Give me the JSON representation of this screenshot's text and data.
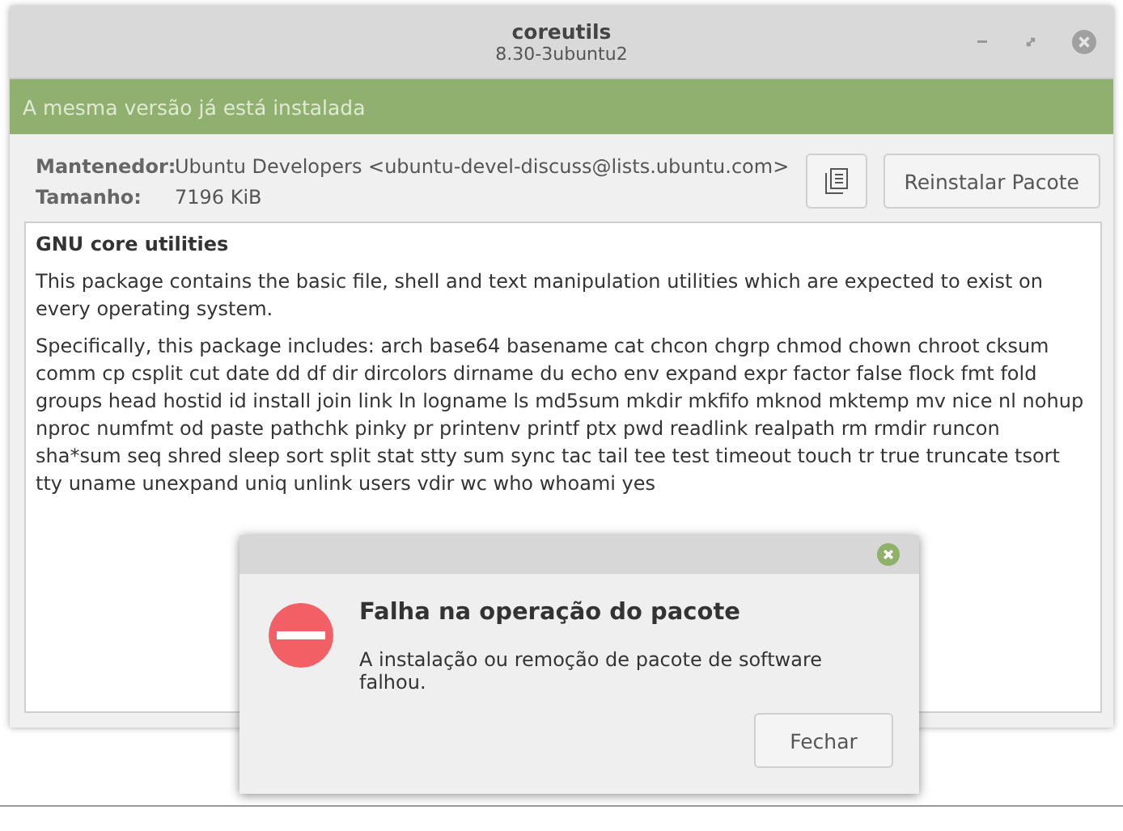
{
  "window": {
    "title": "coreutils",
    "subtitle": "8.30-3ubuntu2"
  },
  "banner": "A mesma versão já está instalada",
  "info": [
    {
      "label": "Mantenedor:",
      "value": "Ubuntu Developers <ubuntu-devel-discuss@lists.ubuntu.com>"
    },
    {
      "label": "Tamanho:",
      "value": "7196 KiB"
    }
  ],
  "reinstall_button": "Reinstalar Pacote",
  "description": {
    "title": "GNU core utilities",
    "paragraphs": [
      "This package contains the basic file, shell and text manipulation utilities which are expected to exist on every operating system.",
      "Specifically, this package includes: arch base64 basename cat chcon chgrp chmod chown chroot cksum comm cp csplit cut date dd df dir dircolors dirname du echo env expand expr factor false flock fmt fold groups head hostid id install join link ln logname ls md5sum mkdir mkfifo mknod mktemp mv nice nl nohup nproc numfmt od paste pathchk pinky pr printenv printf ptx pwd readlink realpath rm rmdir runcon sha*sum seq shred sleep sort split stat stty sum sync tac tail tee test timeout touch tr true truncate tsort tty uname unexpand uniq unlink users vdir wc who whoami yes"
    ]
  },
  "dialog": {
    "title": "Falha na operação do pacote",
    "message": "A instalação ou remoção de pacote de software falhou.",
    "button": "Fechar"
  }
}
